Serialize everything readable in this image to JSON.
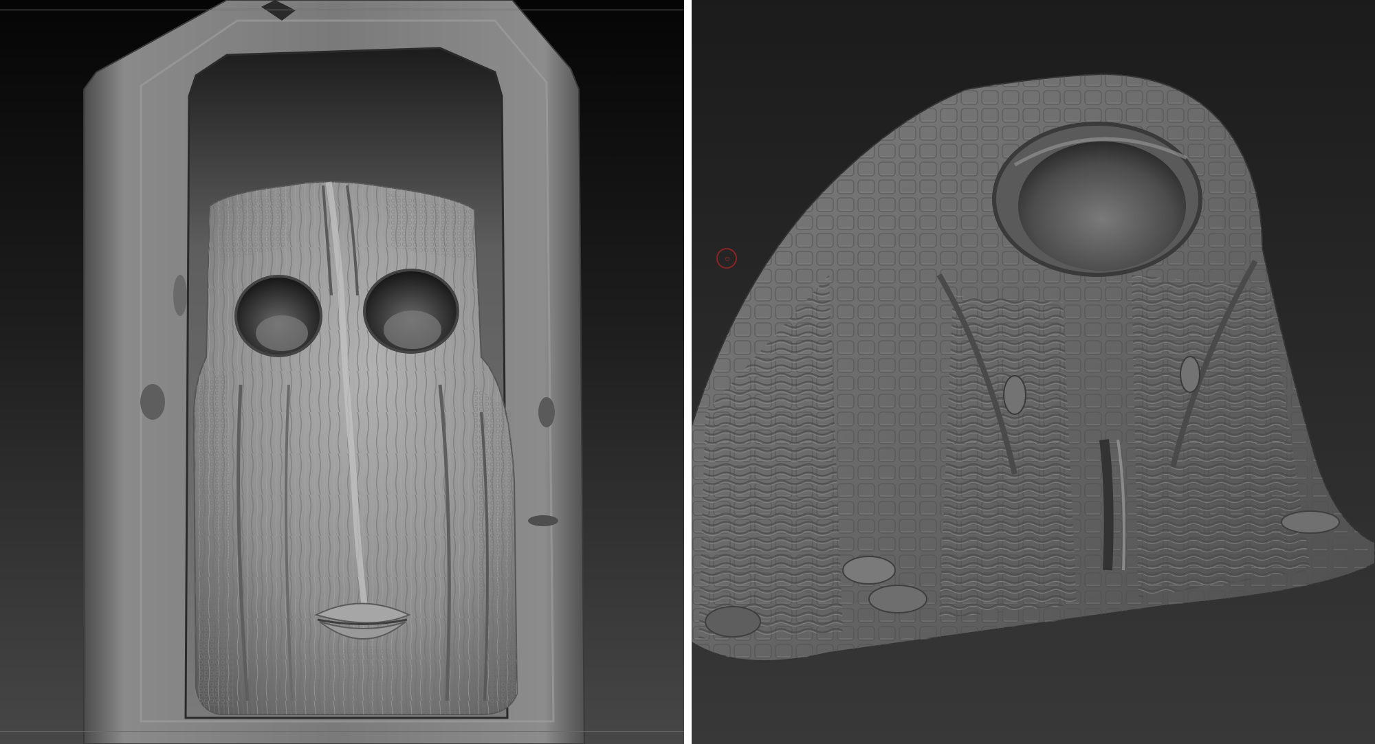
{
  "app": {
    "kind": "sculpting-viewport-comparison",
    "viewports": [
      {
        "id": "left",
        "subject": "skull-mask-in-gothic-frame",
        "background_gradient": [
          "#0a0a0a",
          "#4a4a4a"
        ],
        "surface_color": "#8f8f8f"
      },
      {
        "id": "right",
        "subject": "textured-organic-mound-with-cavity",
        "background_gradient": [
          "#1d1d1d",
          "#3a3a3a"
        ],
        "surface_color": "#6f6f6f"
      }
    ],
    "brush_cursor": {
      "icon": "brush-circle-icon",
      "color": "#8a2424"
    },
    "divider_color": "#ffffff"
  }
}
